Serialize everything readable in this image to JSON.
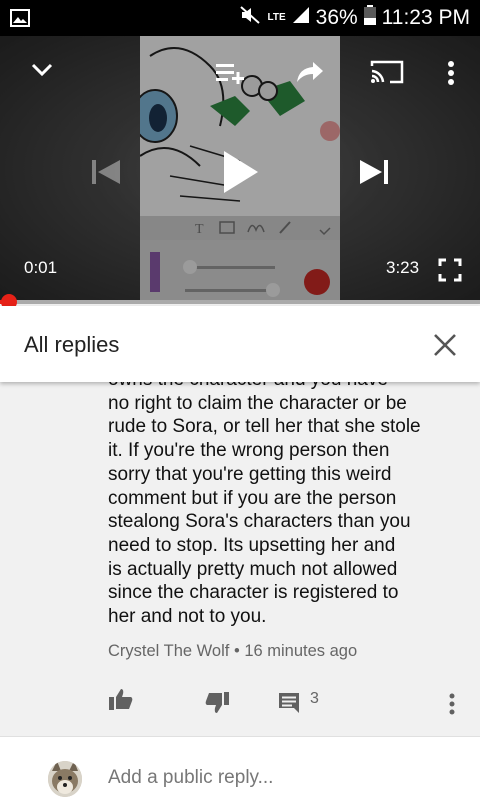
{
  "status_bar": {
    "network": "LTE",
    "battery": "36%",
    "time": "11:23 PM",
    "icons": [
      "gallery-icon",
      "mute-icon",
      "signal-icon",
      "battery-icon"
    ]
  },
  "player": {
    "current_time": "0:01",
    "duration": "3:23",
    "progress_fraction": 0.005,
    "controls": [
      "collapse-icon",
      "add-to-queue-icon",
      "share-icon",
      "cast-icon",
      "more-icon",
      "previous-icon",
      "play-icon",
      "next-icon",
      "fullscreen-icon"
    ]
  },
  "replies_panel": {
    "title": "All replies",
    "close_icon": "close-icon"
  },
  "comment": {
    "lines": [
      "owns the character and you have",
      "no right to claim the character or be",
      "rude to Sora, or tell her that she stole",
      "it. If you're the wrong person then",
      "sorry that you're getting this weird",
      "comment but if you are the person",
      "stealong Sora's characters than you",
      "need to stop. Its upsetting her and",
      "is actually pretty much not allowed",
      "since the character is registered to",
      "her and not to you."
    ],
    "author": "Crystel The Wolf",
    "separator": "•",
    "time_ago": "16 minutes ago",
    "reply_count": "3"
  },
  "reply_bar": {
    "placeholder": "Add a public reply..."
  },
  "colors": {
    "accent": "#e62117",
    "background": "#f1f1f1",
    "icon_gray": "#616161"
  }
}
